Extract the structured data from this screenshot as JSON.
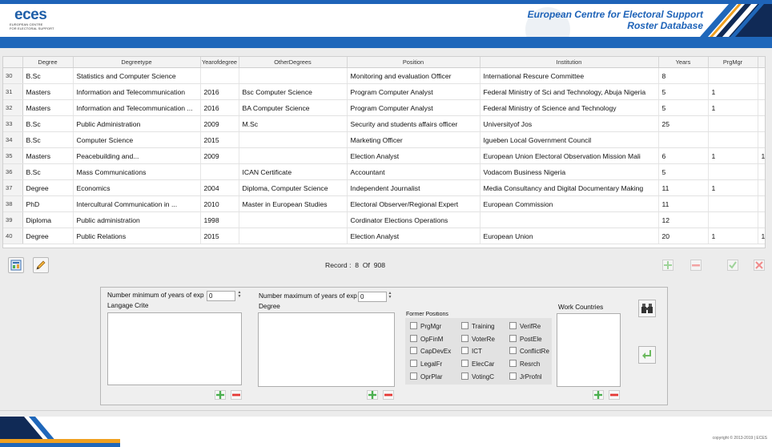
{
  "header": {
    "logo_text": "eces",
    "logo_subtitle_1": "EUROPEAN CENTRE",
    "logo_subtitle_2": "FOR ELECTORAL SUPPORT",
    "title_line1": "European Centre for Electoral Support",
    "title_line2": "Roster Database"
  },
  "table": {
    "columns": [
      "",
      "Degree",
      "Degreetype",
      "Yearofdegree",
      "OtherDegrees",
      "Position",
      "Institution",
      "Years",
      "PrgMgr"
    ],
    "rows": [
      {
        "num": "30",
        "degree": "B.Sc",
        "degreetype": "Statistics and Computer Science",
        "year": "",
        "other": "",
        "position": "Monitoring and evaluation Officer",
        "institution": "International Rescure Committee",
        "years": "8",
        "prgmgr": "",
        "extra": ""
      },
      {
        "num": "31",
        "degree": "Masters",
        "degreetype": "Information and Telecommunication",
        "year": "2016",
        "other": "Bsc Computer Science",
        "position": "Program Computer Analyst",
        "institution": "Federal Ministry of Sci and Technology, Abuja Nigeria",
        "years": "5",
        "prgmgr": "1",
        "extra": ""
      },
      {
        "num": "32",
        "degree": "Masters",
        "degreetype": "Information and Telecommunication ...",
        "year": "2016",
        "other": "BA Computer Science",
        "position": "Program Computer Analyst",
        "institution": "Federal Ministry of Science and Technology",
        "years": "5",
        "prgmgr": "1",
        "extra": ""
      },
      {
        "num": "33",
        "degree": "B.Sc",
        "degreetype": "Public Administration",
        "year": "2009",
        "other": "M.Sc",
        "position": "Security and students affairs officer",
        "institution": "Universityof Jos",
        "years": "25",
        "prgmgr": "",
        "extra": ""
      },
      {
        "num": "34",
        "degree": "B.Sc",
        "degreetype": "Computer Science",
        "year": "2015",
        "other": "",
        "position": "Marketing Officer",
        "institution": "Igueben Local Government Council",
        "years": "",
        "prgmgr": "",
        "extra": ""
      },
      {
        "num": "35",
        "degree": "Masters",
        "degreetype": "Peacebuilding and...",
        "year": "2009",
        "other": "",
        "position": "Election Analyst",
        "institution": "European Union Electoral Observation Mission Mali",
        "years": "6",
        "prgmgr": "1",
        "extra": "1"
      },
      {
        "num": "36",
        "degree": "B.Sc",
        "degreetype": "Mass Communications",
        "year": "",
        "other": "ICAN Certificate",
        "position": "Accountant",
        "institution": "Vodacom Business Nigeria",
        "years": "5",
        "prgmgr": "",
        "extra": ""
      },
      {
        "num": "37",
        "degree": "Degree",
        "degreetype": "Economics",
        "year": "2004",
        "other": "Diploma, Computer Science",
        "position": "Independent Journalist",
        "institution": "Media Consultancy and Digital Documentary Making",
        "years": "11",
        "prgmgr": "1",
        "extra": ""
      },
      {
        "num": "38",
        "degree": "PhD",
        "degreetype": "Intercultural Communication in ...",
        "year": "2010",
        "other": "Master in European Studies",
        "position": "Electoral Observer/Regional Expert",
        "institution": "European Commission",
        "years": "11",
        "prgmgr": "",
        "extra": ""
      },
      {
        "num": "39",
        "degree": "Diploma",
        "degreetype": "Public administration",
        "year": "1998",
        "other": "",
        "position": "Cordinator Elections Operations",
        "institution": "",
        "years": "12",
        "prgmgr": "",
        "extra": ""
      },
      {
        "num": "40",
        "degree": "Degree",
        "degreetype": "Public Relations",
        "year": "2015",
        "other": "",
        "position": "Election Analyst",
        "institution": "European Union",
        "years": "20",
        "prgmgr": "1",
        "extra": "1"
      }
    ]
  },
  "toolbar": {
    "record_label": "Record :",
    "record_current": "8",
    "record_of": "Of",
    "record_total": "908"
  },
  "criteria": {
    "min_years_label": "Number minimum of years of exp",
    "min_years_value": "0",
    "max_years_label": "Number maximum of years of exp",
    "max_years_value": "0",
    "language_label": "Langage Crite",
    "degree_label": "Degree",
    "former_positions_label": "Former Positions",
    "work_countries_label": "Work Countries",
    "positions_col1": [
      "PrgMgr",
      "OpFinM",
      "CapDevEx",
      "LegalFr",
      "OprPlar"
    ],
    "positions_col2": [
      "Training",
      "VoterRe",
      "ICT",
      "ElecCar",
      "VotingC"
    ],
    "positions_col3": [
      "VerifRe",
      "PostEle",
      "ConflictRe",
      "Resrch",
      "JrProfnl"
    ]
  },
  "footer": {
    "copyright": "copyright © 2013-2019 | ECES"
  },
  "colors": {
    "brand_blue": "#1f67ba",
    "title_blue": "#1e63b8",
    "orange_accent": "#f0a020",
    "navy": "#102a56",
    "add_green": "#4caf50",
    "remove_red": "#e53935"
  },
  "icons": [
    "report-icon",
    "edit-pencil-icon",
    "add-record-icon",
    "remove-record-icon",
    "confirm-check-icon",
    "cancel-x-icon",
    "search-binoculars-icon",
    "return-arrow-icon"
  ]
}
